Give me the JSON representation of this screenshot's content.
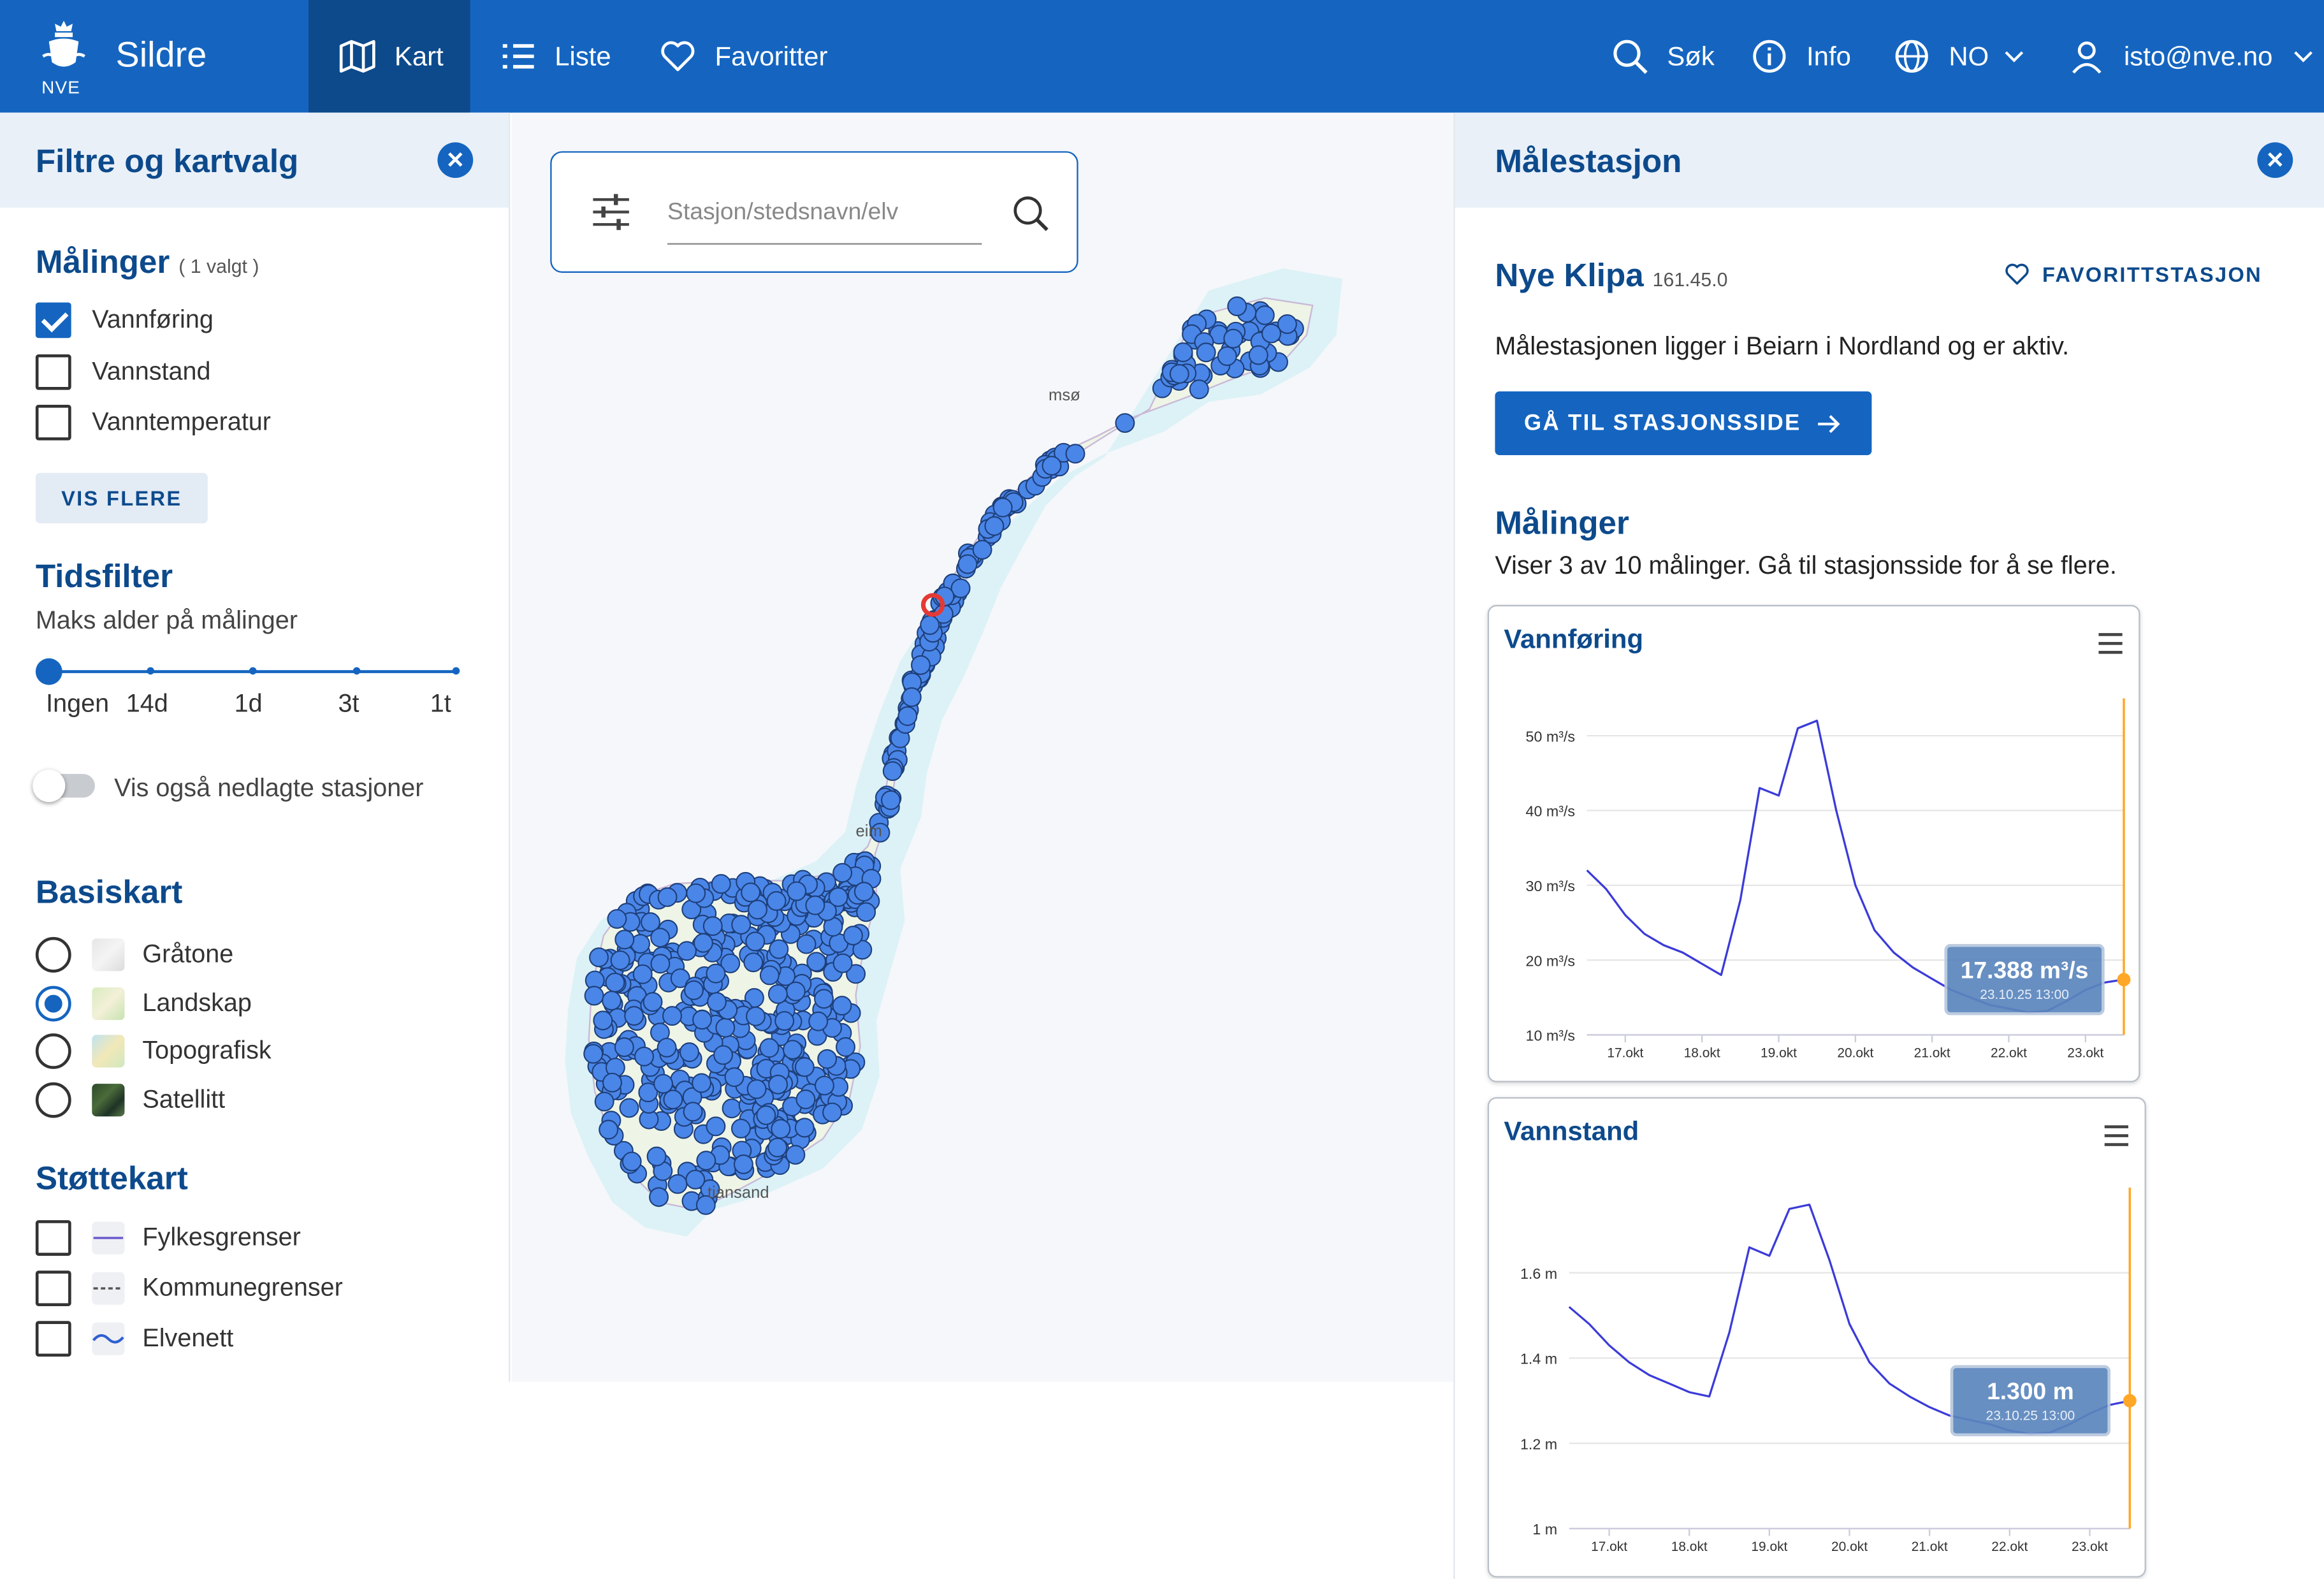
{
  "nav": {
    "brand_initials": "NVE",
    "app_name": "Sildre",
    "items": [
      {
        "label": "Kart",
        "icon": "map-icon",
        "active": true
      },
      {
        "label": "Liste",
        "icon": "list-icon",
        "active": false
      },
      {
        "label": "Favoritter",
        "icon": "heart-icon",
        "active": false
      }
    ],
    "search_label": "Søk",
    "info_label": "Info",
    "language_label": "NO",
    "user_label": "isto@nve.no",
    "colors": {
      "bar": "#1565c0",
      "active": "#0d4a8c"
    }
  },
  "filters": {
    "title": "Filtre og kartvalg",
    "measurements": {
      "title": "Målinger",
      "count": "1 valgt",
      "items": [
        {
          "label": "Vannføring",
          "checked": true
        },
        {
          "label": "Vannstand",
          "checked": false
        },
        {
          "label": "Vanntemperatur",
          "checked": false
        }
      ],
      "more_button": "VIS FLERE"
    },
    "time": {
      "title": "Tidsfilter",
      "subtitle": "Maks alder på målinger",
      "ticks": [
        "Ingen",
        "14d",
        "1d",
        "3t",
        "1t"
      ],
      "selected": "Ingen"
    },
    "show_closed": {
      "label": "Vis også nedlagte stasjoner",
      "on": false
    },
    "basemap": {
      "title": "Basiskart",
      "items": [
        {
          "label": "Gråtone",
          "checked": false
        },
        {
          "label": "Landskap",
          "checked": true
        },
        {
          "label": "Topografisk",
          "checked": false
        },
        {
          "label": "Satellitt",
          "checked": false
        }
      ]
    },
    "overlays": {
      "title": "Støttekart",
      "items": [
        {
          "label": "Fylkesgrenser",
          "checked": false
        },
        {
          "label": "Kommunegrenser",
          "checked": false
        },
        {
          "label": "Elvenett",
          "checked": false
        }
      ]
    }
  },
  "map": {
    "search_placeholder": "Stasjon/stedsnavn/elv",
    "labels": {
      "north": "msø",
      "middle": "eim",
      "south": "tiansand"
    },
    "station_color": "#4a86e8",
    "selected_color": "#e53935"
  },
  "station_panel": {
    "title": "Målestasjon",
    "name": "Nye Klipa",
    "code": "161.45.0",
    "favorite_label": "FAVORITTSTASJON",
    "description": "Målestasjonen ligger i Beiarn i Nordland og er aktiv.",
    "go_button": "GÅ TIL STASJONSSIDE",
    "measurements_title": "Målinger",
    "measurements_desc": "Viser 3 av 10 målinger. Gå til stasjonsside for å se flere."
  },
  "chart_data": [
    {
      "type": "line",
      "title": "Vannføring",
      "x": [
        "16.okt 12:00",
        "16.okt 18:00",
        "17.okt 00:00",
        "17.okt 06:00",
        "17.okt 12:00",
        "17.okt 18:00",
        "18.okt 00:00",
        "18.okt 06:00",
        "18.okt 12:00",
        "18.okt 18:00",
        "19.okt 00:00",
        "19.okt 06:00",
        "19.okt 12:00",
        "19.okt 18:00",
        "20.okt 00:00",
        "20.okt 06:00",
        "20.okt 12:00",
        "20.okt 18:00",
        "21.okt 00:00",
        "21.okt 06:00",
        "21.okt 12:00",
        "21.okt 18:00",
        "22.okt 00:00",
        "22.okt 06:00",
        "22.okt 12:00",
        "22.okt 18:00",
        "23.okt 00:00",
        "23.okt 06:00",
        "23.okt 13:00"
      ],
      "series": [
        {
          "values": [
            32,
            29.5,
            26,
            23.5,
            22,
            21,
            19.5,
            18,
            28,
            43,
            42,
            51,
            52,
            40,
            30,
            24,
            21,
            19,
            17.5,
            16,
            15,
            14,
            13.5,
            13,
            13.2,
            14.5,
            16,
            17,
            17.388
          ]
        }
      ],
      "y_ticks": [
        "10 m³/s",
        "20 m³/s",
        "30 m³/s",
        "40 m³/s",
        "50 m³/s"
      ],
      "x_ticks": [
        "17.okt",
        "18.okt",
        "19.okt",
        "20.okt",
        "21.okt",
        "22.okt",
        "23.okt"
      ],
      "ylim": [
        10,
        55
      ],
      "tooltip": {
        "value": "17.388 m³/s",
        "time": "23.10.25 13:00"
      },
      "line_color": "#3b3bd9",
      "marker_color": "#ffa726",
      "grid": true
    },
    {
      "type": "line",
      "title": "Vannstand",
      "x": [
        "16.okt 12:00",
        "16.okt 18:00",
        "17.okt 00:00",
        "17.okt 06:00",
        "17.okt 12:00",
        "17.okt 18:00",
        "18.okt 00:00",
        "18.okt 06:00",
        "18.okt 12:00",
        "18.okt 18:00",
        "19.okt 00:00",
        "19.okt 06:00",
        "19.okt 12:00",
        "19.okt 18:00",
        "20.okt 00:00",
        "20.okt 06:00",
        "20.okt 12:00",
        "20.okt 18:00",
        "21.okt 00:00",
        "21.okt 06:00",
        "21.okt 12:00",
        "21.okt 18:00",
        "22.okt 00:00",
        "22.okt 06:00",
        "22.okt 12:00",
        "22.okt 18:00",
        "23.okt 00:00",
        "23.okt 06:00",
        "23.okt 13:00"
      ],
      "series": [
        {
          "values": [
            1.52,
            1.48,
            1.43,
            1.39,
            1.36,
            1.34,
            1.32,
            1.31,
            1.46,
            1.66,
            1.64,
            1.75,
            1.76,
            1.63,
            1.48,
            1.39,
            1.34,
            1.31,
            1.285,
            1.265,
            1.255,
            1.245,
            1.23,
            1.222,
            1.225,
            1.245,
            1.27,
            1.29,
            1.3
          ]
        }
      ],
      "y_ticks": [
        "1 m",
        "1.2 m",
        "1.4 m",
        "1.6 m"
      ],
      "x_ticks": [
        "17.okt",
        "18.okt",
        "19.okt",
        "20.okt",
        "21.okt",
        "22.okt",
        "23.okt"
      ],
      "ylim": [
        1.0,
        1.8
      ],
      "tooltip": {
        "value": "1.300 m",
        "time": "23.10.25 13:00"
      },
      "line_color": "#3b3bd9",
      "marker_color": "#ffa726",
      "grid": true
    }
  ]
}
